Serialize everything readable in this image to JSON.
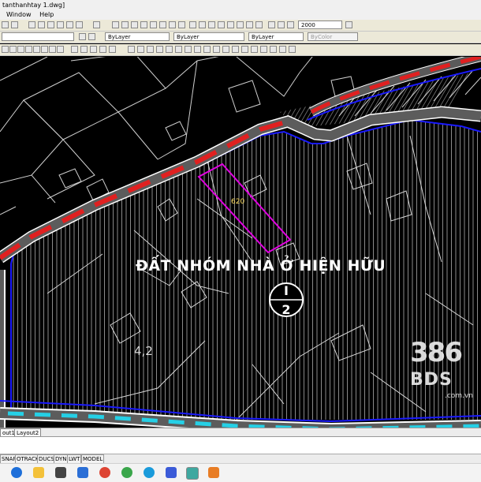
{
  "window": {
    "title": "tanthanhtay 1.dwg]"
  },
  "menu": {
    "items": [
      "Window",
      "Help"
    ]
  },
  "properties": {
    "layer_value": "ByLayer",
    "linetype_value": "ByLayer",
    "lineweight_value": "ByLayer",
    "plotstyle_value": "ByColor",
    "scale_value": "2000"
  },
  "drawing": {
    "zone_label": "ĐẤT NHÓM NHÀ Ở HIỆN HỮU",
    "zone_code_top": "I",
    "zone_code_bottom": "2",
    "lot_number": "620",
    "elevation_label": "4,2"
  },
  "watermark": {
    "number": "386",
    "brand": "BDS",
    "url": ".com.vn"
  },
  "layout_tabs": [
    "out1",
    "Layout2"
  ],
  "status_toggles": [
    "SNAP",
    "OTRACK",
    "DUCS",
    "DYN",
    "LWT",
    "MODEL"
  ],
  "colors": {
    "road_red": "#e02020",
    "boundary_blue": "#1a1aff",
    "lot_magenta": "#e000e0",
    "hatch": "#9a9a9a"
  }
}
